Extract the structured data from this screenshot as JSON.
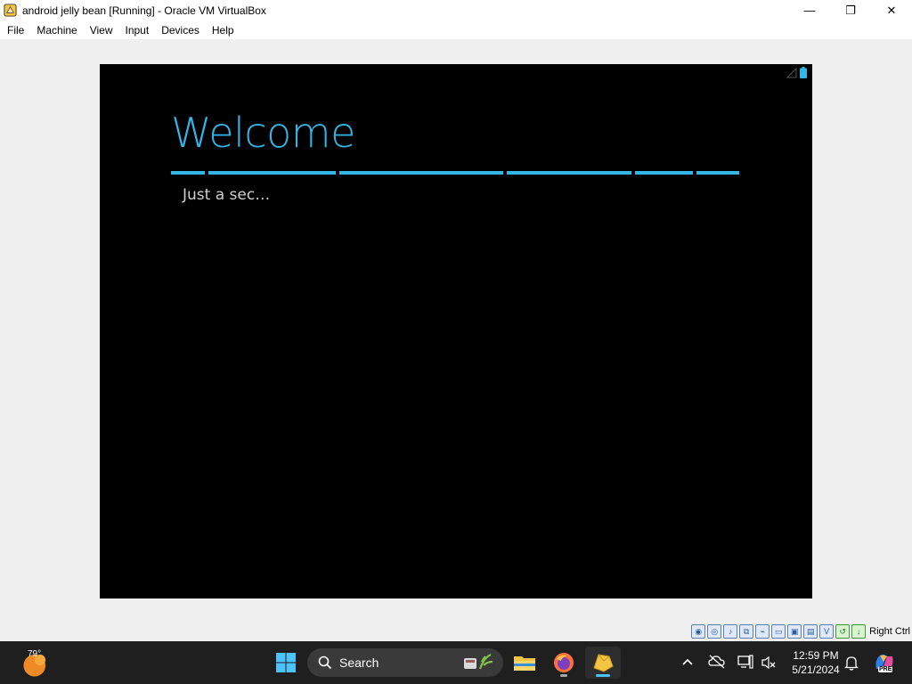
{
  "window": {
    "title": "android jelly bean [Running] - Oracle VM VirtualBox",
    "minimize_glyph": "—",
    "maximize_glyph": "❐",
    "close_glyph": "✕"
  },
  "menu": {
    "items": [
      "File",
      "Machine",
      "View",
      "Input",
      "Devices",
      "Help"
    ]
  },
  "vm": {
    "heading": "Welcome",
    "status_text": "Just a sec…",
    "accent_color": "#33b5e5"
  },
  "vbox_status": {
    "host_key": "Right Ctrl",
    "icons": [
      "hard-disk-icon",
      "optical-drive-icon",
      "audio-icon",
      "network-icon",
      "usb-icon",
      "shared-folders-icon",
      "display-icon",
      "recording-icon",
      "cpu-icon",
      "mouse-integration-icon",
      "keyboard-icon"
    ]
  },
  "taskbar": {
    "weather_temp": "79°",
    "search_label": "Search",
    "clock_time": "12:59 PM",
    "clock_date": "5/21/2024",
    "copilot_badge": "PRE"
  }
}
